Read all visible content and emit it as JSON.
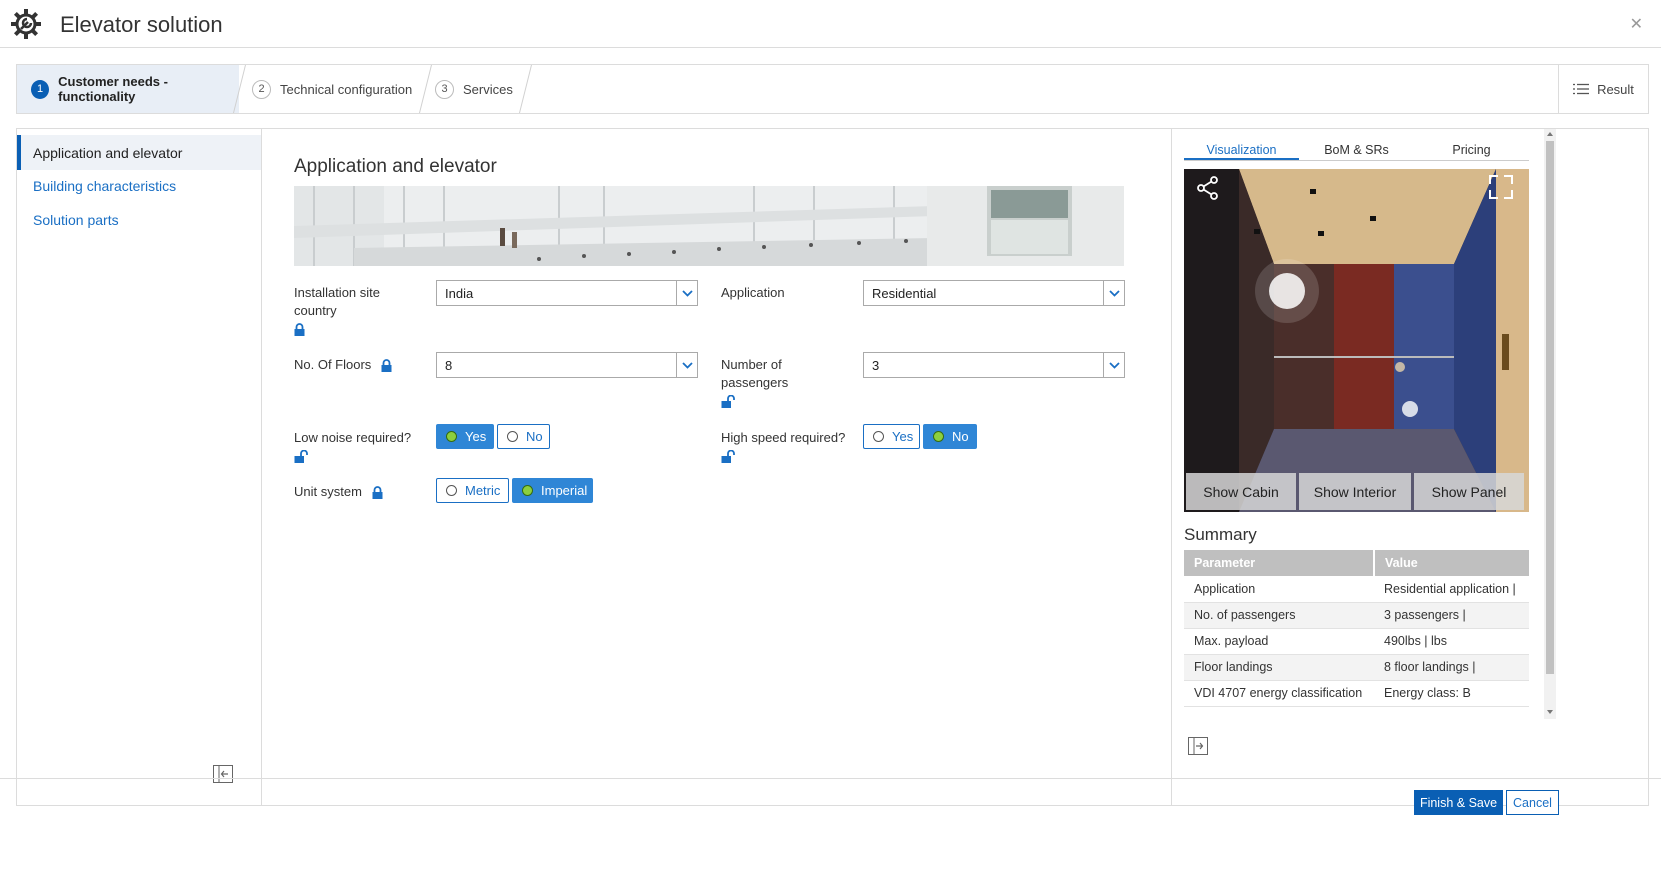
{
  "app": {
    "title": "Elevator solution",
    "logo_icon": "gear-wrench-icon",
    "close_icon": "close-icon"
  },
  "wizard": {
    "steps": [
      {
        "num": "1",
        "label": "Customer needs - functionality",
        "active": true
      },
      {
        "num": "2",
        "label": "Technical configuration",
        "active": false
      },
      {
        "num": "3",
        "label": "Services",
        "active": false
      }
    ],
    "result_label": "Result"
  },
  "sidebar": {
    "items": [
      {
        "label": "Application and elevator",
        "active": true
      },
      {
        "label": "Building characteristics",
        "active": false
      },
      {
        "label": "Solution parts",
        "active": false
      }
    ]
  },
  "form": {
    "title": "Application and elevator",
    "installation_site": {
      "label": "Installation site country",
      "value": "India",
      "locked": true
    },
    "application": {
      "label": "Application",
      "value": "Residential"
    },
    "floors": {
      "label": "No. Of Floors",
      "value": "8",
      "locked": true
    },
    "passengers": {
      "label": "Number of passengers",
      "value": "3",
      "locked": false
    },
    "low_noise": {
      "label": "Low noise required?",
      "yes": "Yes",
      "no": "No",
      "selected": "Yes"
    },
    "high_speed": {
      "label": "High speed required?",
      "yes": "Yes",
      "no": "No",
      "selected": "No"
    },
    "unit_system": {
      "label": "Unit system",
      "metric": "Metric",
      "imperial": "Imperial",
      "selected": "Imperial"
    }
  },
  "rightpane": {
    "tabs": [
      "Visualization",
      "BoM & SRs",
      "Pricing"
    ],
    "active_tab": "Visualization",
    "viz_buttons": [
      "Show Cabin",
      "Show Interior",
      "Show Panel"
    ],
    "summary": {
      "title": "Summary",
      "headers": [
        "Parameter",
        "Value"
      ],
      "rows": [
        [
          "Application",
          "Residential application |"
        ],
        [
          "No. of passengers",
          "3 passengers |"
        ],
        [
          "Max. payload",
          "490lbs | lbs"
        ],
        [
          "Floor landings",
          "8 floor landings |"
        ],
        [
          "VDI 4707 energy classification",
          "Energy class: B"
        ]
      ]
    }
  },
  "footer": {
    "finish_label": "Finish & Save",
    "cancel_label": "Cancel"
  },
  "colors": {
    "accent": "#0a5fb4",
    "selected_dot": "#8ccf3e",
    "link": "#1a6fc4"
  }
}
